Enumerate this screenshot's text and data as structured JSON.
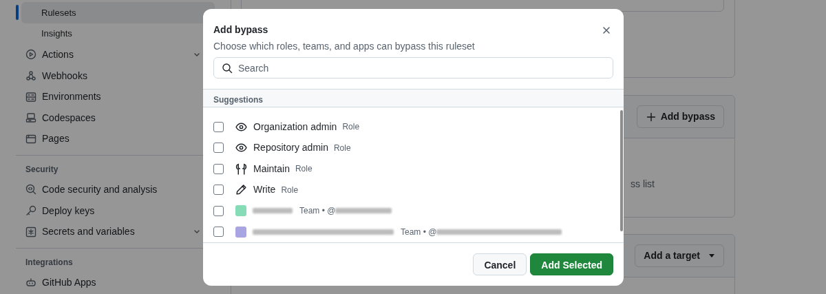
{
  "sidebar": {
    "items": [
      {
        "kind": "subitem",
        "label": "Rulesets",
        "selected": true
      },
      {
        "kind": "subitem",
        "label": "Insights",
        "selected": false
      },
      {
        "kind": "item",
        "label": "Actions",
        "selected": false,
        "expandable": true
      },
      {
        "kind": "item",
        "label": "Webhooks",
        "selected": false
      },
      {
        "kind": "item",
        "label": "Environments",
        "selected": false
      },
      {
        "kind": "item",
        "label": "Codespaces",
        "selected": false
      },
      {
        "kind": "item",
        "label": "Pages",
        "selected": false
      },
      {
        "kind": "heading",
        "label": "Security"
      },
      {
        "kind": "item",
        "label": "Code security and analysis",
        "selected": false
      },
      {
        "kind": "item",
        "label": "Deploy keys",
        "selected": false
      },
      {
        "kind": "item",
        "label": "Secrets and variables",
        "selected": false,
        "expandable": true
      },
      {
        "kind": "heading",
        "label": "Integrations"
      },
      {
        "kind": "item",
        "label": "GitHub Apps",
        "selected": false
      }
    ]
  },
  "main": {
    "bypass_card": {
      "button": "Add bypass",
      "empty_text": "ss list"
    },
    "target_card": {
      "button": "Add a target"
    }
  },
  "modal": {
    "title": "Add bypass",
    "subtitle": "Choose which roles, teams, and apps can bypass this ruleset",
    "search": {
      "placeholder": "Search"
    },
    "section": "Suggestions",
    "suggestions": [
      {
        "kind": "role",
        "name": "Organization admin",
        "type": "Role",
        "checked": false
      },
      {
        "kind": "role",
        "name": "Repository admin",
        "type": "Role",
        "checked": false
      },
      {
        "kind": "role",
        "name": "Maintain",
        "type": "Role",
        "checked": false
      },
      {
        "kind": "role",
        "name": "Write",
        "type": "Role",
        "checked": false
      },
      {
        "kind": "team",
        "type": "Team • @",
        "color": "#86dcb7",
        "checked": false
      },
      {
        "kind": "team",
        "type": "Team • @",
        "color": "#a9a5e2",
        "checked": false
      }
    ],
    "buttons": [
      {
        "kind": "secondary",
        "label": "Cancel"
      },
      {
        "kind": "primary",
        "label": "Add Selected"
      }
    ]
  }
}
